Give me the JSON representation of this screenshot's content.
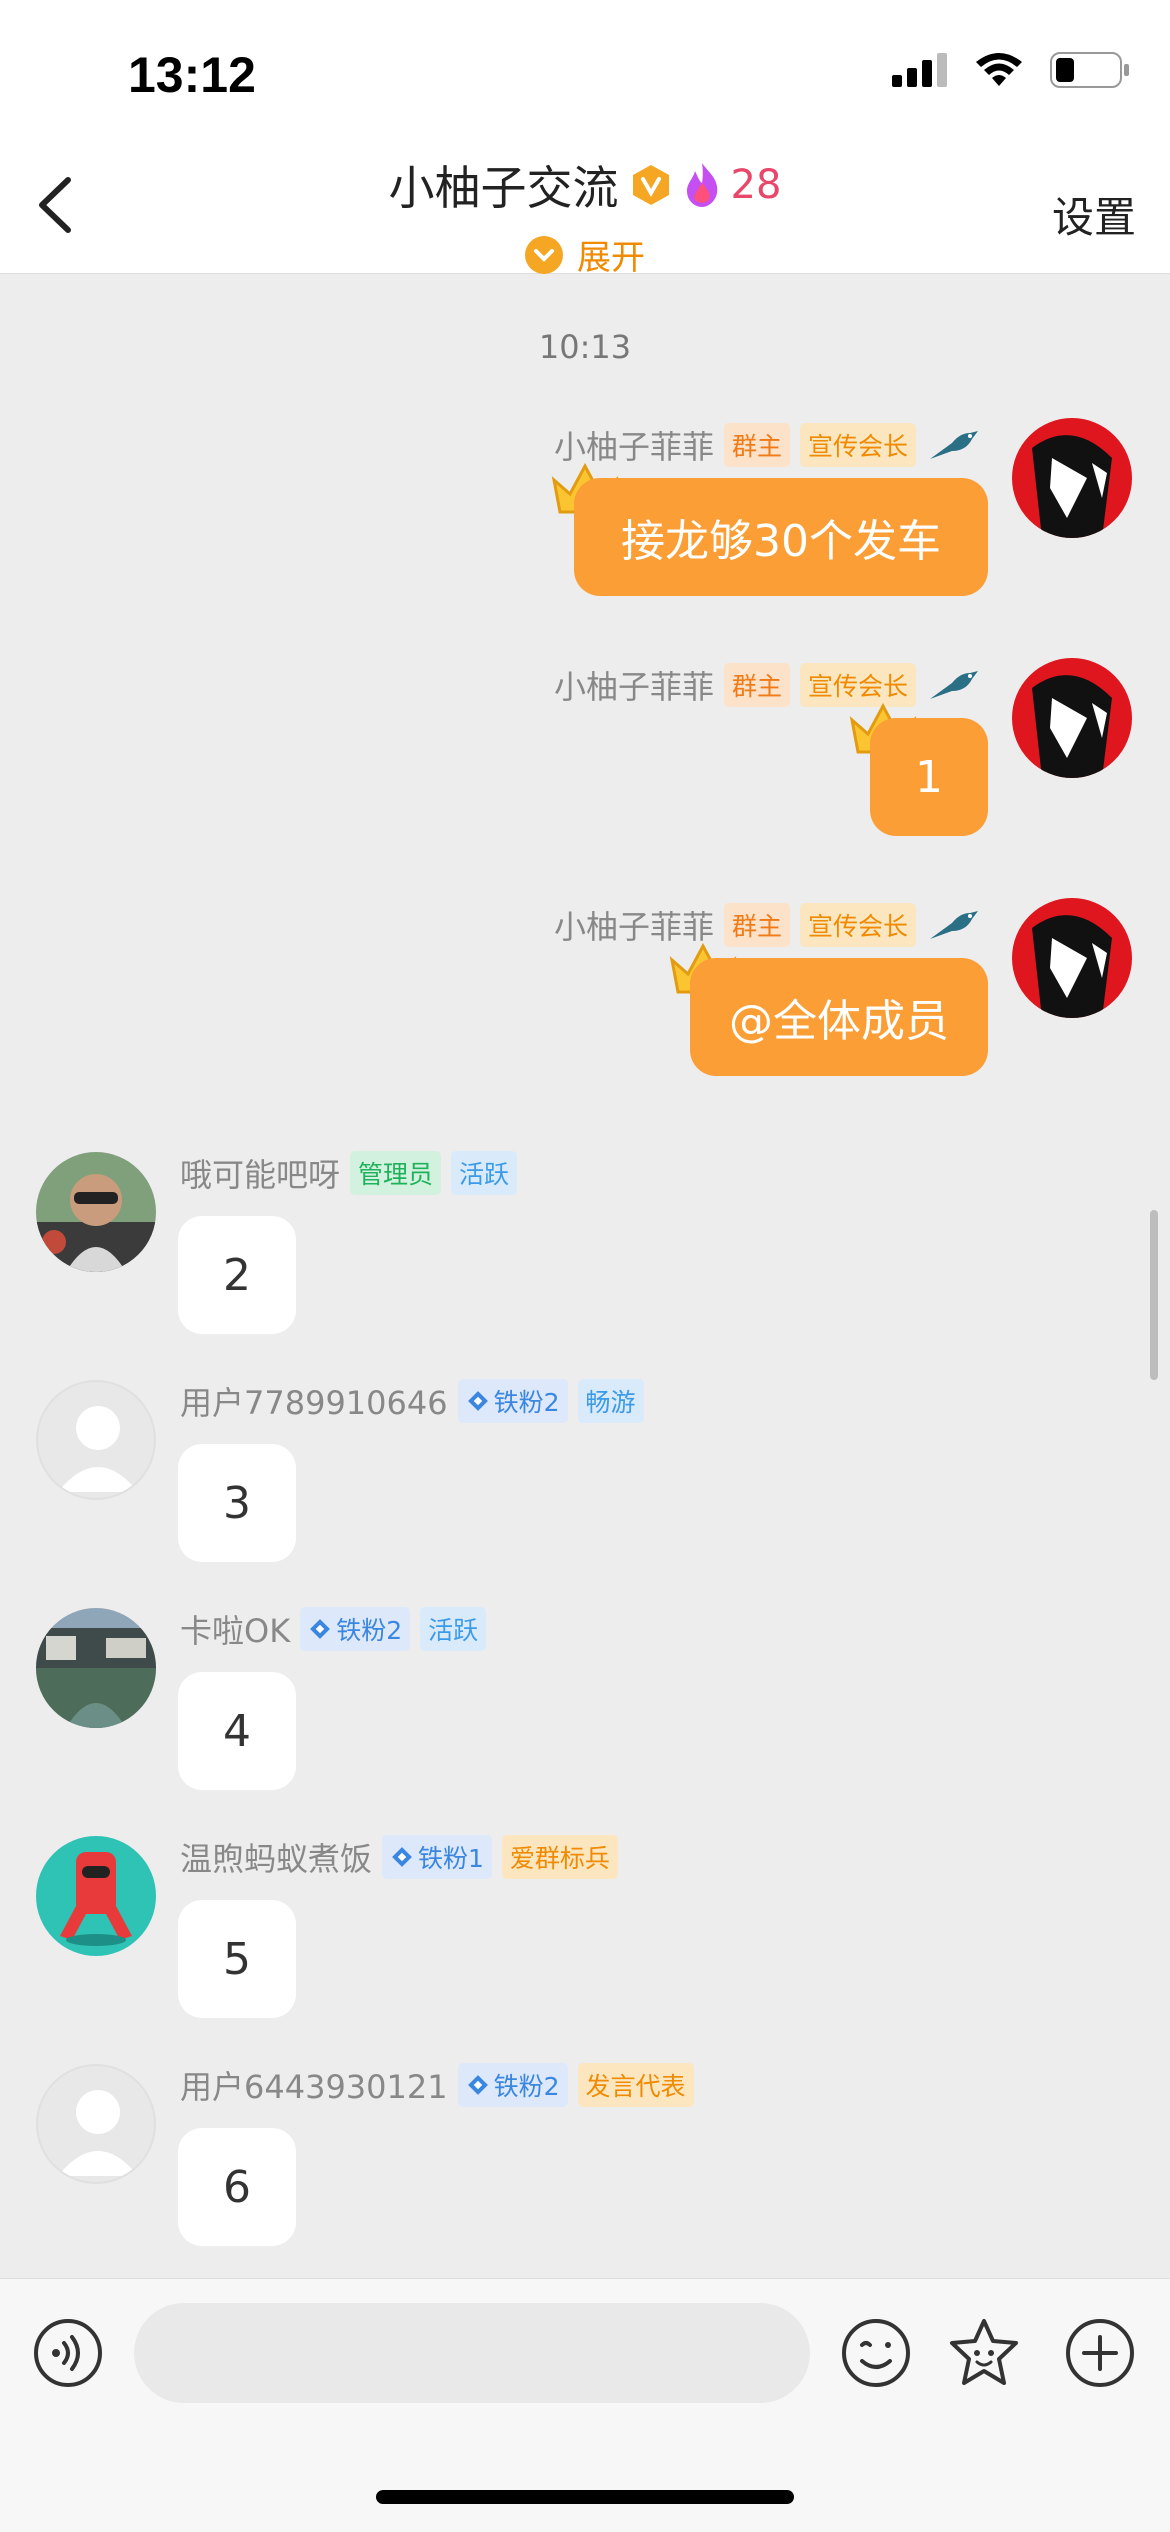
{
  "status_bar": {
    "time": "13:12"
  },
  "header": {
    "title": "小柚子交流",
    "fire_count": "28",
    "expand_label": "展开",
    "settings_label": "设置"
  },
  "chat": {
    "timestamp": "10:13",
    "owner_messages": [
      {
        "name": "小柚子菲菲",
        "tag_role": "群主",
        "tag_title": "宣传会长",
        "text": "接龙够30个发车"
      },
      {
        "name": "小柚子菲菲",
        "tag_role": "群主",
        "tag_title": "宣传会长",
        "text": "1"
      },
      {
        "name": "小柚子菲菲",
        "tag_role": "群主",
        "tag_title": "宣传会长",
        "text": "@全体成员"
      }
    ],
    "member_messages": [
      {
        "name": "哦可能吧呀",
        "tag1": "管理员",
        "tag2": "活跃",
        "text": "2"
      },
      {
        "name": "用户7789910646",
        "tag1": "铁粉2",
        "tag2": "畅游",
        "text": "3"
      },
      {
        "name": "卡啦OK",
        "tag1": "铁粉2",
        "tag2": "活跃",
        "text": "4"
      },
      {
        "name": "温煦蚂蚁煮饭",
        "tag1": "铁粉1",
        "tag2": "爱群标兵",
        "text": "5"
      },
      {
        "name": "用户6443930121",
        "tag1": "铁粉2",
        "tag2": "发言代表",
        "text": "6"
      }
    ]
  },
  "input_bar": {
    "placeholder": ""
  },
  "colors": {
    "accent_orange": "#fb9e36",
    "background": "#ededed"
  }
}
